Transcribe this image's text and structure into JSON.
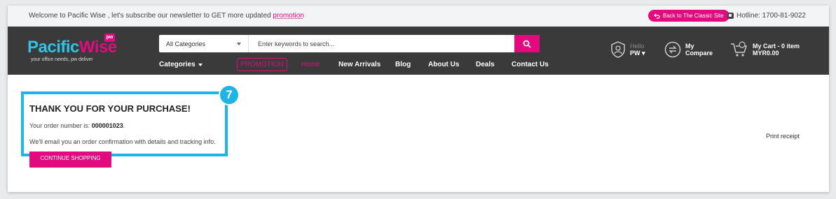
{
  "topbar": {
    "welcome_text": "Welcome to Pacific Wise , let's subscribe our newsletter to GET more updated",
    "promotion_link": "promotion",
    "classic_site_label": "Back to The Classic Site",
    "hotline": "Hotline: 1700-81-9022"
  },
  "brand": {
    "name_part1": "Pacific",
    "name_part2": "Wise",
    "badge": "pw",
    "tagline": "your office needs, pw deliver",
    "primary_color": "#e5097f",
    "secondary_color": "#31c3e5"
  },
  "search": {
    "category": "All Categories",
    "placeholder": "Enter keywords to search..."
  },
  "nav": {
    "categories": "Categories",
    "promotion": "PROMOTION",
    "home": "Home",
    "new_arrivals": "New Arrivals",
    "blog": "Blog",
    "about_us": "About Us",
    "deals": "Deals",
    "contact_us": "Contact Us"
  },
  "account": {
    "hello": "Hello",
    "user": "PW"
  },
  "compare": {
    "line1": "My",
    "line2": "Compare"
  },
  "cart": {
    "line1": "My Cart - 0 item",
    "line2": "MYR0.00"
  },
  "main": {
    "title": "THANK YOU FOR YOUR PURCHASE!",
    "order_label": "Your order number is:",
    "order_number": "000001023",
    "email_message": "We'll email you an order confirmation with details and tracking info.",
    "continue_label": "CONTINUE SHOPPING",
    "print_receipt": "Print receipt",
    "step_number": "7"
  }
}
